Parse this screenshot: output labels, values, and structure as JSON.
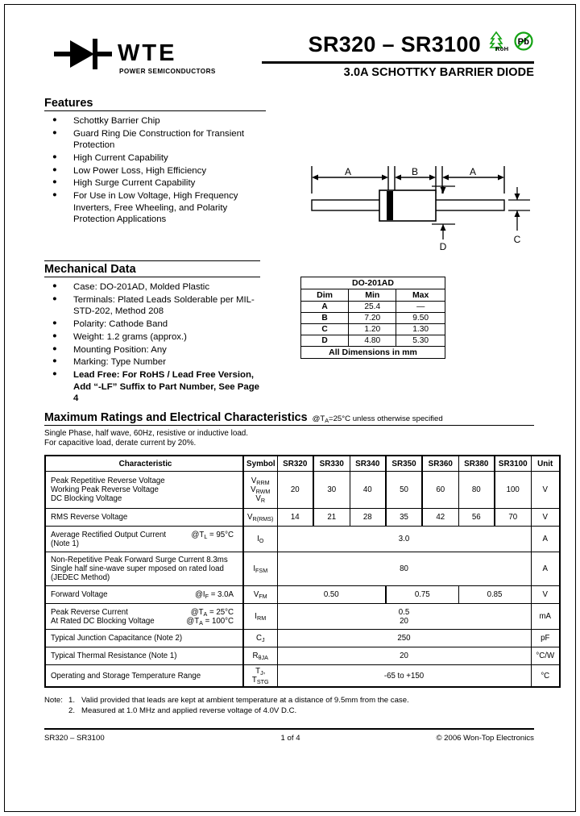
{
  "brand": {
    "name": "WTE",
    "tagline": "POWER SEMICONDUCTORS",
    "logo_icon": "diode-symbol-icon"
  },
  "header": {
    "part_range": "SR320 – SR3100",
    "subtitle": "3.0A SCHOTTKY BARRIER DIODE",
    "rohs_icon_label": "RoHS",
    "pb_icon_label": "Pb",
    "icon_color": "#13a313"
  },
  "features": {
    "heading": "Features",
    "items": [
      "Schottky Barrier Chip",
      "Guard Ring Die Construction for Transient Protection",
      "High Current Capability",
      "Low Power Loss, High Efficiency",
      "High Surge Current Capability",
      "For Use in Low Voltage, High Frequency Inverters, Free Wheeling, and Polarity Protection Applications"
    ]
  },
  "mechanical": {
    "heading": "Mechanical Data",
    "items": [
      {
        "text": "Case: DO-201AD, Molded Plastic",
        "bold": false
      },
      {
        "text": "Terminals: Plated Leads Solderable per MIL-STD-202, Method 208",
        "bold": false
      },
      {
        "text": "Polarity: Cathode Band",
        "bold": false
      },
      {
        "text": "Weight: 1.2 grams (approx.)",
        "bold": false
      },
      {
        "text": "Mounting Position: Any",
        "bold": false
      },
      {
        "text": "Marking: Type Number",
        "bold": false
      },
      {
        "text": "Lead Free: For RoHS / Lead Free Version, Add “-LF” Suffix to Part Number, See Page 4",
        "bold": true
      }
    ]
  },
  "package_drawing": {
    "labels": {
      "a_left": "A",
      "b": "B",
      "a_right": "A",
      "d": "D",
      "c": "C"
    }
  },
  "dim_table": {
    "title": "DO-201AD",
    "headers": [
      "Dim",
      "Min",
      "Max"
    ],
    "rows": [
      {
        "dim": "A",
        "min": "25.4",
        "max": "—"
      },
      {
        "dim": "B",
        "min": "7.20",
        "max": "9.50"
      },
      {
        "dim": "C",
        "min": "1.20",
        "max": "1.30"
      },
      {
        "dim": "D",
        "min": "4.80",
        "max": "5.30"
      }
    ],
    "footer": "All Dimensions in mm"
  },
  "ratings": {
    "title": "Maximum Ratings and Electrical Characteristics",
    "condition": "@TA=25°C unless otherwise specified",
    "note_line1": "Single Phase, half wave, 60Hz, resistive or inductive load.",
    "note_line2": "For capacitive load, derate current by 20%.",
    "headers": {
      "characteristic": "Characteristic",
      "symbol": "Symbol",
      "parts": [
        "SR320",
        "SR330",
        "SR340",
        "SR350",
        "SR360",
        "SR380",
        "SR3100"
      ],
      "unit": "Unit"
    },
    "rows": [
      {
        "name_lines": [
          "Peak Repetitive Reverse Voltage",
          "Working Peak Reverse Voltage",
          "DC Blocking Voltage"
        ],
        "condition": "",
        "symbol_lines": [
          "VRRM",
          "VRWM",
          "VR"
        ],
        "values": [
          "20",
          "30",
          "40",
          "50",
          "60",
          "80",
          "100"
        ],
        "unit": "V"
      },
      {
        "name_lines": [
          "RMS Reverse Voltage"
        ],
        "condition": "",
        "symbol_lines": [
          "VR(RMS)"
        ],
        "values": [
          "14",
          "21",
          "28",
          "35",
          "42",
          "56",
          "70"
        ],
        "unit": "V"
      },
      {
        "name_lines": [
          "Average Rectified Output Current",
          "(Note 1)"
        ],
        "condition": "@TL = 95°C",
        "symbol_lines": [
          "IO"
        ],
        "span_value": "3.0",
        "unit": "A"
      },
      {
        "name_lines": [
          "Non-Repetitive Peak Forward Surge Current 8.3ms",
          "Single half sine-wave super mposed on rated load",
          "(JEDEC Method)"
        ],
        "condition": "",
        "symbol_lines": [
          "IFSM"
        ],
        "span_value": "80",
        "unit": "A"
      },
      {
        "name_lines": [
          "Forward Voltage"
        ],
        "condition": "@IF = 3.0A",
        "symbol_lines": [
          "VFM"
        ],
        "group_values": [
          "0.50",
          "0.75",
          "0.85"
        ],
        "unit": "V"
      },
      {
        "name_lines": [
          "Peak Reverse Current",
          "At Rated DC Blocking Voltage"
        ],
        "condition_lines": [
          "@TA = 25°C",
          "@TA = 100°C"
        ],
        "symbol_lines": [
          "IRM"
        ],
        "span_value_lines": [
          "0.5",
          "20"
        ],
        "unit": "mA"
      },
      {
        "name_lines": [
          "Typical Junction Capacitance (Note 2)"
        ],
        "condition": "",
        "symbol_lines": [
          "CJ"
        ],
        "span_value": "250",
        "unit": "pF"
      },
      {
        "name_lines": [
          "Typical Thermal Resistance (Note 1)"
        ],
        "condition": "",
        "symbol_lines": [
          "RθJA"
        ],
        "span_value": "20",
        "unit": "°C/W"
      },
      {
        "name_lines": [
          "Operating and Storage Temperature Range"
        ],
        "condition": "",
        "symbol_lines": [
          "TJ, TSTG"
        ],
        "span_value": "-65 to +150",
        "unit": "°C"
      }
    ]
  },
  "notes": {
    "label": "Note:",
    "items": [
      {
        "num": "1.",
        "text": "Valid provided that leads are kept at ambient temperature at a distance of 9.5mm from the case."
      },
      {
        "num": "2.",
        "text": "Measured at 1.0 MHz and applied reverse voltage of 4.0V D.C."
      }
    ]
  },
  "footer": {
    "left": "SR320 – SR3100",
    "center": "1 of 4",
    "right": "© 2006 Won-Top Electronics"
  }
}
